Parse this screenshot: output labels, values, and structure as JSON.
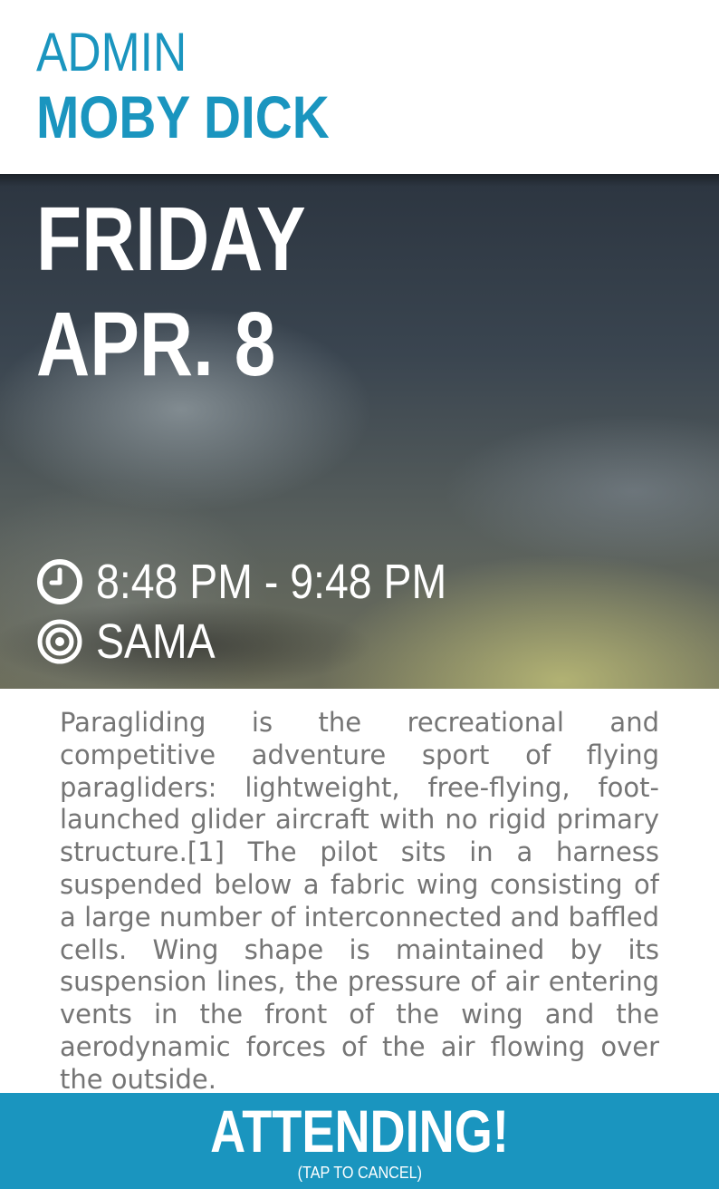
{
  "header": {
    "subtitle": "ADMIN",
    "title": "MOBY DICK"
  },
  "event": {
    "day": "FRIDAY",
    "date": "APR. 8",
    "time": "8:48 PM - 9:48 PM",
    "location": "SAMA",
    "time_icon": "clock-icon",
    "location_icon": "location-target-icon",
    "description": "Paragliding is the recreational and competitive adventure sport of flying paragliders: lightweight, free-flying, foot-launched glider aircraft with no rigid primary structure.[1] The pilot sits in a harness suspended below a fabric wing consisting of a large number of interconnected and baffled cells. Wing shape is maintained by its suspension lines, the pressure of air entering vents in the front of the wing and the aerodynamic forces of the air flowing over the outside."
  },
  "attend_button": {
    "label": "ATTENDING!",
    "sublabel": "(TAP TO CANCEL)"
  },
  "colors": {
    "accent": "#1a95bf",
    "text_gray": "#757575",
    "white": "#ffffff"
  }
}
